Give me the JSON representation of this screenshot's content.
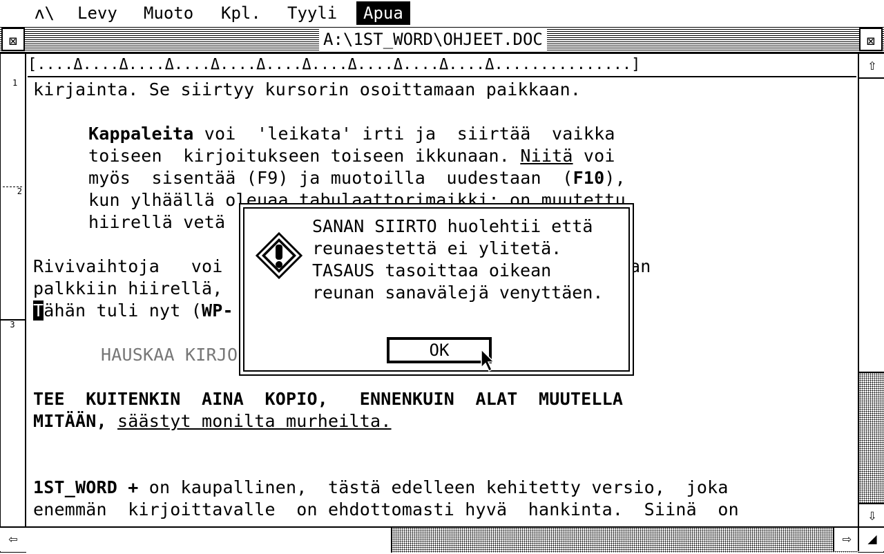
{
  "menubar": {
    "logo": "ʌ\\",
    "items": [
      {
        "label": "Levy"
      },
      {
        "label": "Muoto"
      },
      {
        "label": "Kpl."
      },
      {
        "label": "Tyyli"
      },
      {
        "label": "Apua",
        "active": true
      }
    ]
  },
  "window": {
    "title": "A:\\1ST_WORD\\OHJEET.DOC",
    "close_glyph": "⊠",
    "full_glyph": "⊠"
  },
  "ruler": "[....Δ....Δ....Δ....Δ....Δ....Δ....Δ....Δ....Δ....Δ...............]",
  "margin_marks": [
    "1",
    "2",
    "3"
  ],
  "document": {
    "line1": "kirjainta. Se siirtyy kursorin osoittamaan paikkaan.",
    "p2_l1_bold": "Kappaleita",
    "p2_l1_rest": " voi  'leikata' irti ja  siirtää  vaikka",
    "p2_l2_a": "toiseen  kirjoitukseen toiseen ikkunaan. ",
    "p2_l2_u": "Niitä",
    "p2_l2_b": " voi",
    "p2_l3_a": "myös  sisentää (F9) ja muotoilla  uudestaan  (",
    "p2_l3_b": "F10",
    "p2_l3_c": "),",
    "p2_l4": "kun ylhäällä oleuaa tabulaattorimaikki: on muutettu",
    "p2_l5": "hiirellä vetä",
    "p3_l1_a": "Rivivaihtoja   voi",
    "p3_l1_b": "an",
    "p3_l2": "palkkiin hiirellä,",
    "p3_l3_cursor": "T",
    "p3_l3_rest": "ähän tuli nyt (",
    "p3_l3_b": "WP-",
    "grey_line": "HAUSKAA KIRJO",
    "caps_l1": "TEE  KUITENKIN  AINA  KOPIO,   ENNENKUIN  ALAT  MUUTELLA",
    "caps_l2_bold": "MITÄÄN,",
    "caps_l2_u": "säästyt monilta murheilta.",
    "last_l1_bold": "1ST_WORD +",
    "last_l1_rest": " on kaupallinen,  tästä edelleen kehitetty versio,  joka",
    "last_l2": "enemmän  kirjoittavalle  on ehdottomasti hyvä  hankinta.  Siinä  on"
  },
  "dialog": {
    "lines": [
      "SANAN SIIRTO huolehtii että",
      "reunaestettä ei ylitetä.",
      "TASAUS tasoittaa oikean",
      "reunan sanavälejä venyttäen."
    ],
    "ok_label": "OK",
    "icon": "warning-icon"
  },
  "scroll": {
    "up_glyph": "⇧",
    "down_glyph": "⇩",
    "left_glyph": "⇦",
    "right_glyph": "⇨",
    "size_glyph": "◢"
  }
}
